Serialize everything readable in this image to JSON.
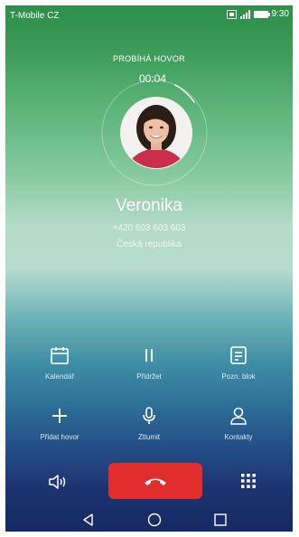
{
  "status_bar": {
    "carrier": "T-Mobile CZ",
    "time": "9:30",
    "icons": [
      "sim-icon",
      "signal-icon",
      "battery-icon"
    ]
  },
  "call": {
    "status": "PROBÍHÁ HOVOR",
    "timer": "00:04",
    "name": "Veronika",
    "number": "+420 603 603 603",
    "country": "Česká republika"
  },
  "actions": {
    "calendar": "Kalendář",
    "hold": "Přidržet",
    "notes": "Pozn. blok",
    "add_call": "Přidat hovor",
    "mute": "Ztlumit",
    "contacts": "Kontakty"
  },
  "colors": {
    "end_call": "#e22d2d",
    "top_gradient": "#2e8f4a",
    "bottom_gradient": "#152a62"
  }
}
